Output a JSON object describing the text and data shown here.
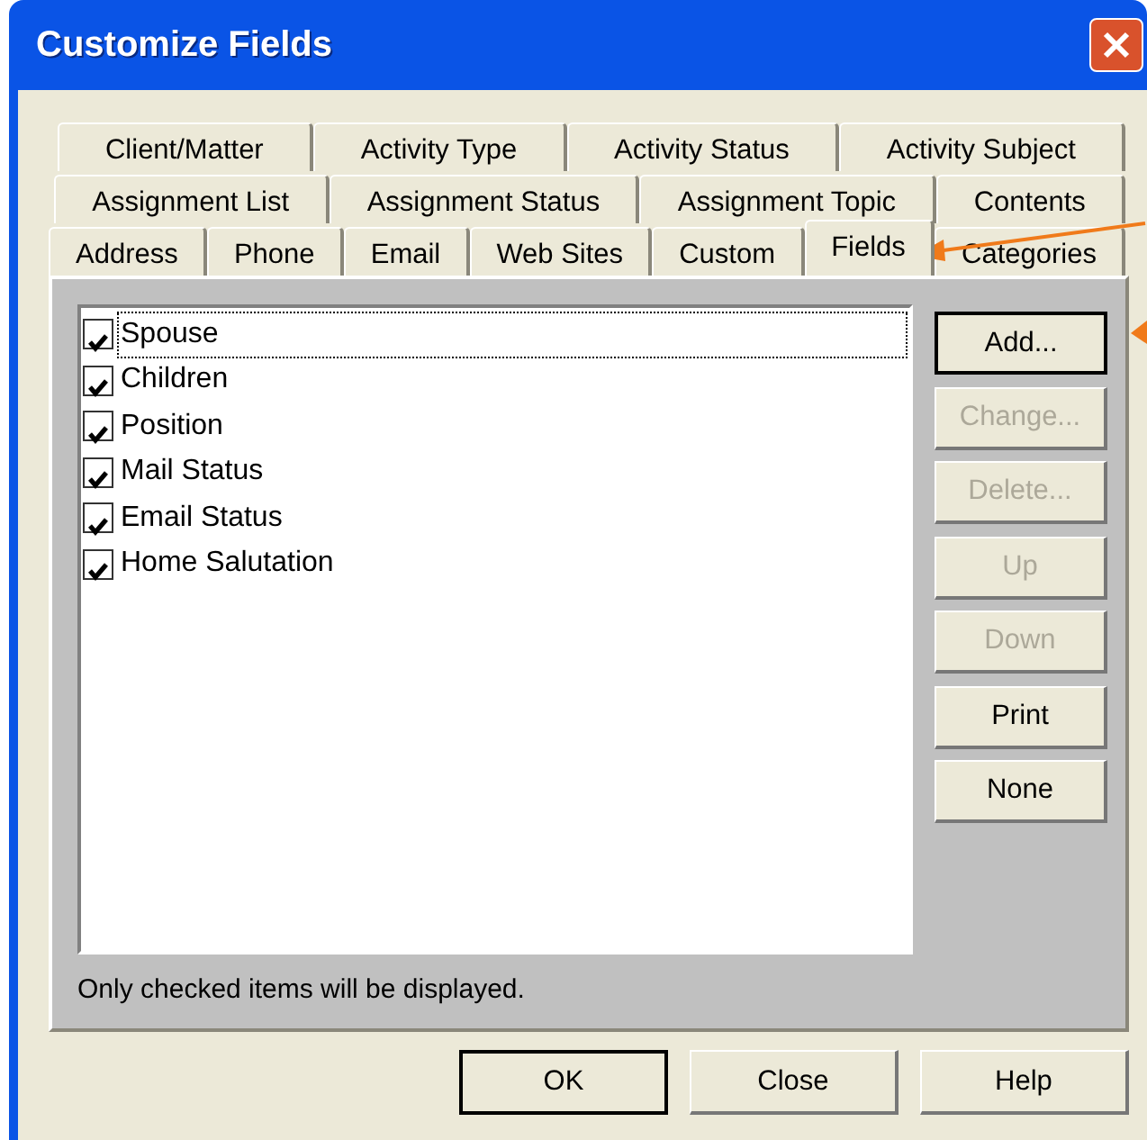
{
  "window": {
    "title": "Customize Fields"
  },
  "tab_rows": [
    [
      {
        "label": "Client/Matter",
        "selected": false
      },
      {
        "label": "Activity Type",
        "selected": false
      },
      {
        "label": "Activity Status",
        "selected": false
      },
      {
        "label": "Activity Subject",
        "selected": false
      }
    ],
    [
      {
        "label": "Assignment List",
        "selected": false
      },
      {
        "label": "Assignment Status",
        "selected": false
      },
      {
        "label": "Assignment Topic",
        "selected": false
      },
      {
        "label": "Contents",
        "selected": false
      }
    ],
    [
      {
        "label": "Address",
        "selected": false
      },
      {
        "label": "Phone",
        "selected": false
      },
      {
        "label": "Email",
        "selected": false
      },
      {
        "label": "Web Sites",
        "selected": false
      },
      {
        "label": "Custom",
        "selected": false
      },
      {
        "label": "Fields",
        "selected": true
      },
      {
        "label": "Categories",
        "selected": false
      }
    ]
  ],
  "fields": [
    {
      "label": "Spouse",
      "checked": true,
      "focused": true
    },
    {
      "label": "Children",
      "checked": true,
      "focused": false
    },
    {
      "label": "Position",
      "checked": true,
      "focused": false
    },
    {
      "label": "Mail Status",
      "checked": true,
      "focused": false
    },
    {
      "label": "Email Status",
      "checked": true,
      "focused": false
    },
    {
      "label": "Home Salutation",
      "checked": true,
      "focused": false
    }
  ],
  "side_buttons": [
    {
      "label": "Add...",
      "disabled": false,
      "default": true
    },
    {
      "label": "Change...",
      "disabled": true,
      "default": false
    },
    {
      "label": "Delete...",
      "disabled": true,
      "default": false
    },
    {
      "label": "Up",
      "disabled": true,
      "default": false
    },
    {
      "label": "Down",
      "disabled": true,
      "default": false
    },
    {
      "label": "Print",
      "disabled": false,
      "default": false
    },
    {
      "label": "None",
      "disabled": false,
      "default": false
    }
  ],
  "note": "Only checked items will be displayed.",
  "footer_buttons": [
    {
      "label": "OK",
      "default": true
    },
    {
      "label": "Close",
      "default": false
    },
    {
      "label": "Help",
      "default": false
    }
  ],
  "annotations": [
    {
      "kind": "arrow"
    },
    {
      "kind": "arrow"
    }
  ]
}
